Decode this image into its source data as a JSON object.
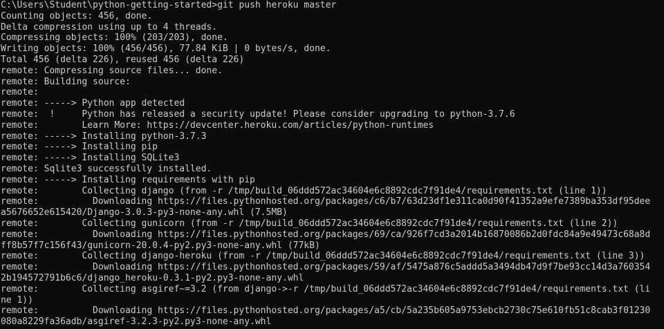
{
  "terminal": {
    "lines": [
      "C:\\Users\\Student\\python-getting-started>git push heroku master",
      "Counting objects: 456, done.",
      "Delta compression using up to 4 threads.",
      "Compressing objects: 100% (203/203), done.",
      "Writing objects: 100% (456/456), 77.84 KiB | 0 bytes/s, done.",
      "Total 456 (delta 226), reused 456 (delta 226)",
      "remote: Compressing source files... done.",
      "remote: Building source:",
      "remote:",
      "remote: -----> Python app detected",
      "remote:  !     Python has released a security update! Please consider upgrading to python-3.7.6",
      "remote:        Learn More: https://devcenter.heroku.com/articles/python-runtimes",
      "remote: -----> Installing python-3.7.3",
      "remote: -----> Installing pip",
      "remote: -----> Installing SQLite3",
      "remote: Sqlite3 successfully installed.",
      "remote: -----> Installing requirements with pip",
      "remote:        Collecting django (from -r /tmp/build_06ddd572ac34604e6c8892cdc7f91de4/requirements.txt (line 1))",
      "remote:          Downloading https://files.pythonhosted.org/packages/c6/b7/63d23df1e311ca0d90f41352a9efe7389ba353df95dee",
      "a5676652e615420/Django-3.0.3-py3-none-any.whl (7.5MB)",
      "remote:        Collecting gunicorn (from -r /tmp/build_06ddd572ac34604e6c8892cdc7f91de4/requirements.txt (line 2))",
      "remote:          Downloading https://files.pythonhosted.org/packages/69/ca/926f7cd3a2014b16870086b2d0fdc84a9e49473c68a8d",
      "ff8b57f7c156f43/gunicorn-20.0.4-py2.py3-none-any.whl (77kB)",
      "remote:        Collecting django-heroku (from -r /tmp/build_06ddd572ac34604e6c8892cdc7f91de4/requirements.txt (line 3))",
      "remote:          Downloading https://files.pythonhosted.org/packages/59/af/5475a876c5addd5a3494db47d9f7be93cc14d3a760354",
      "2b194572791b6c6/django_heroku-0.3.1-py2.py3-none-any.whl",
      "remote:        Collecting asgiref~=3.2 (from django->-r /tmp/build_06ddd572ac34604e6c8892cdc7f91de4/requirements.txt (li",
      "ne 1))",
      "remote:          Downloading https://files.pythonhosted.org/packages/a5/cb/5a235b605a9753ebcb2730c75e610fb51c8cab3f01230",
      "080a8229fa36adb/asgiref-3.2.3-py2.py3-none-any.whl"
    ]
  }
}
